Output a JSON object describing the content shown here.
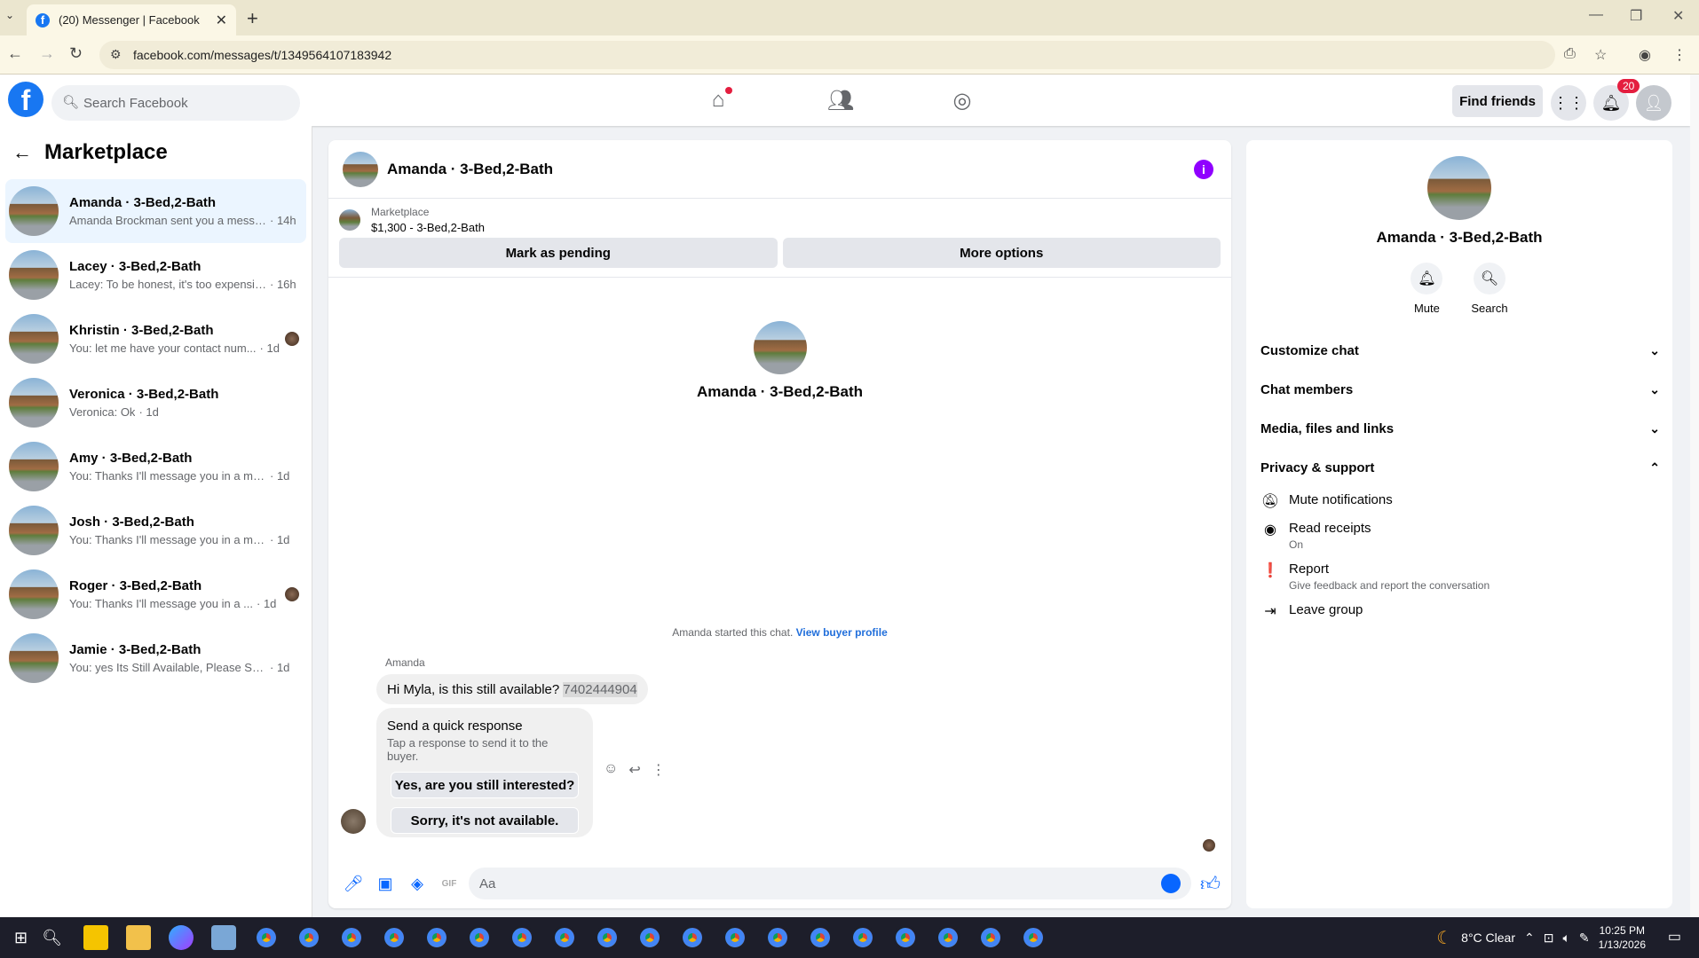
{
  "browser": {
    "tab_title": "(20) Messenger | Facebook",
    "url": "facebook.com/messages/t/1349564107183942"
  },
  "fb": {
    "search_placeholder": "Search Facebook",
    "find_friends": "Find friends",
    "notif_count": "20"
  },
  "sidebar": {
    "title": "Marketplace",
    "conversations": [
      {
        "name": "Amanda · 3-Bed,2-Bath",
        "preview": "Amanda Brockman sent you a messa...",
        "time": "· 14h"
      },
      {
        "name": "Lacey · 3-Bed,2-Bath",
        "preview": "Lacey: To be honest, it's too expensiv...",
        "time": "· 16h"
      },
      {
        "name": "Khristin · 3-Bed,2-Bath",
        "preview": "You: let me have your contact num...",
        "time": "· 1d"
      },
      {
        "name": "Veronica · 3-Bed,2-Bath",
        "preview": "Veronica: Ok",
        "time": "· 1d"
      },
      {
        "name": "Amy · 3-Bed,2-Bath",
        "preview": "You: Thanks I'll message you in a mo...",
        "time": "· 1d"
      },
      {
        "name": "Josh · 3-Bed,2-Bath",
        "preview": "You: Thanks I'll message you in a mo...",
        "time": "· 1d"
      },
      {
        "name": "Roger · 3-Bed,2-Bath",
        "preview": "You: Thanks I'll message you in a ...",
        "time": "· 1d"
      },
      {
        "name": "Jamie · 3-Bed,2-Bath",
        "preview": "You: yes Its Still Available, Please Send...",
        "time": "· 1d"
      }
    ]
  },
  "chat": {
    "header": "Amanda · 3-Bed,2-Bath",
    "mp_label": "Marketplace",
    "mp_listing": "$1,300 - 3-Bed,2-Bath",
    "mark_pending": "Mark as pending",
    "more_options": "More options",
    "center_title": "Amanda · 3-Bed,2-Bath",
    "started": "Amanda started this chat.",
    "view_profile": "View buyer profile",
    "sender": "Amanda",
    "message": "Hi Myla, is this still available?",
    "phone": "7402444904",
    "qr_title": "Send a quick response",
    "qr_sub": "Tap a response to send it to the buyer.",
    "qr_1": "Yes, are you still interested?",
    "qr_2": "Sorry, it's not available.",
    "composer_placeholder": "Aa"
  },
  "right": {
    "name": "Amanda · 3-Bed,2-Bath",
    "mute": "Mute",
    "search": "Search",
    "sections": [
      "Customize chat",
      "Chat members",
      "Media, files and links",
      "Privacy & support"
    ],
    "mute_notifications": "Mute notifications",
    "read_receipts": "Read receipts",
    "read_receipts_sub": "On",
    "report": "Report",
    "report_sub": "Give feedback and report the conversation",
    "leave": "Leave group"
  },
  "taskbar": {
    "weather": "8°C  Clear",
    "time": "10:25 PM",
    "date": "1/13/2026"
  }
}
